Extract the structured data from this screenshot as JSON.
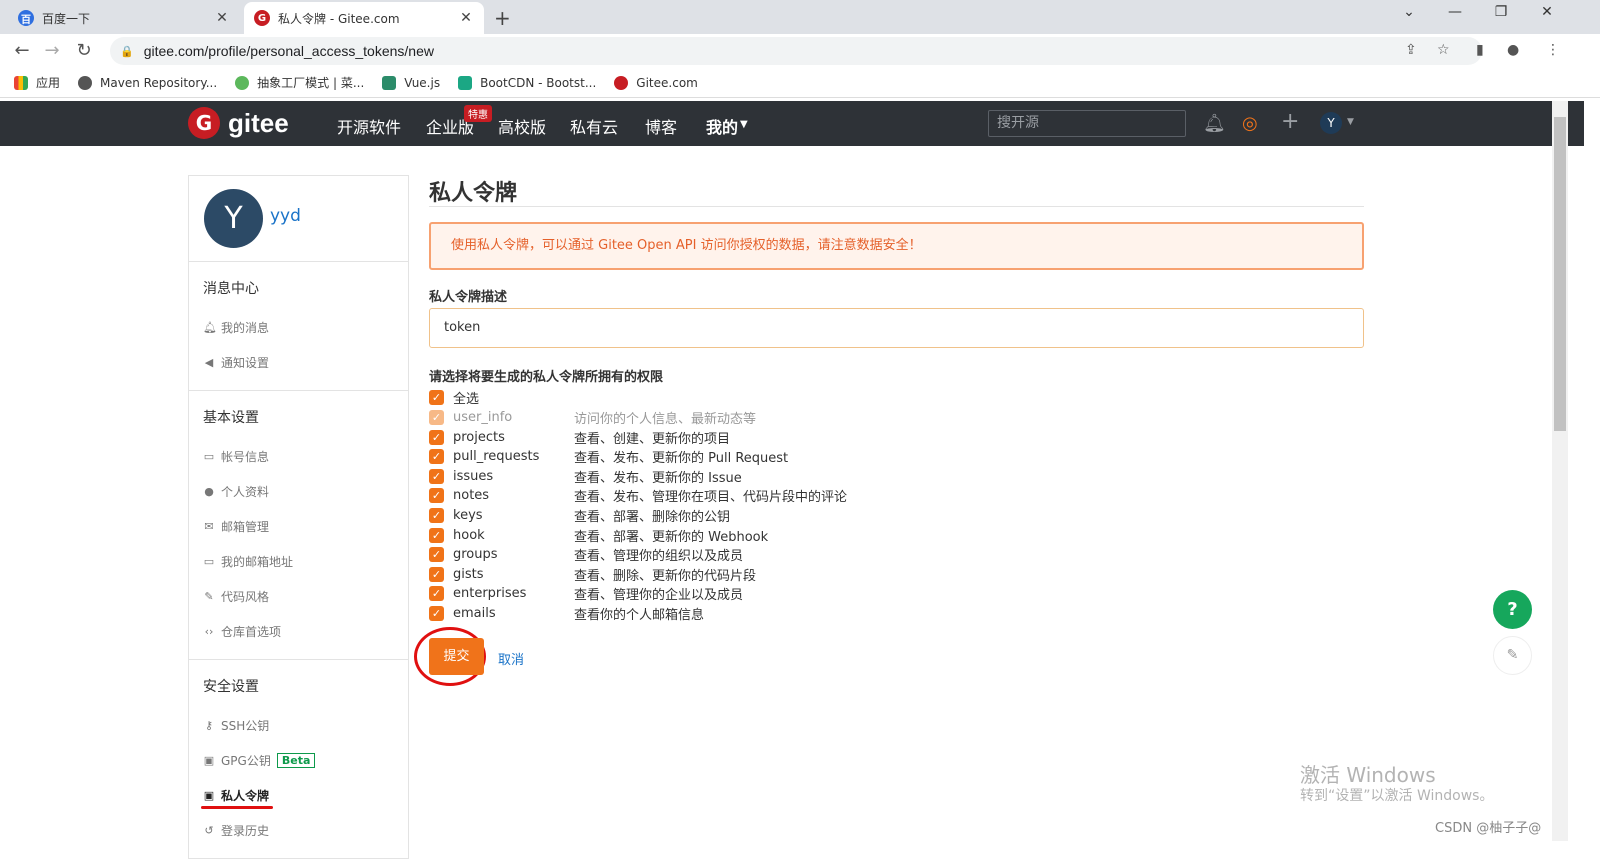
{
  "browser": {
    "tabs": [
      {
        "label": "百度一下",
        "active": false
      },
      {
        "label": "私人令牌 - Gitee.com",
        "active": true
      }
    ],
    "url": "gitee.com/profile/personal_access_tokens/new",
    "bookmarks": [
      "应用",
      "Maven Repository...",
      "抽象工厂模式 | 菜...",
      "Vue.js",
      "BootCDN - Bootst...",
      "Gitee.com"
    ]
  },
  "gitee_nav": {
    "logo_text": "gitee",
    "items": [
      "开源软件",
      "企业版",
      "高校版",
      "私有云",
      "博客",
      "我的"
    ],
    "hot_badge": "特惠",
    "search_placeholder": "搜开源",
    "user_initial": "Y"
  },
  "sidebar": {
    "avatar_initial": "Y",
    "username": "yyd",
    "sections": [
      {
        "title": "消息中心",
        "items": [
          "我的消息",
          "通知设置"
        ]
      },
      {
        "title": "基本设置",
        "items": [
          "帐号信息",
          "个人资料",
          "邮箱管理",
          "我的邮箱地址",
          "代码风格",
          "仓库首选项"
        ]
      },
      {
        "title": "安全设置",
        "items": [
          "SSH公钥",
          "GPG公钥",
          "私人令牌",
          "登录历史"
        ]
      }
    ],
    "beta_label": "Beta",
    "active_item": "私人令牌"
  },
  "main": {
    "title": "私人令牌",
    "alert": "使用私人令牌，可以通过 Gitee Open API 访问你授权的数据，请注意数据安全！",
    "desc_label": "私人令牌描述",
    "desc_value": "token",
    "perm_label": "请选择将要生成的私人令牌所拥有的权限",
    "select_all": "全选",
    "permissions": [
      {
        "name": "user_info",
        "desc": "访问你的个人信息、最新动态等",
        "disabled": true
      },
      {
        "name": "projects",
        "desc": "查看、创建、更新你的项目"
      },
      {
        "name": "pull_requests",
        "desc": "查看、发布、更新你的 Pull Request"
      },
      {
        "name": "issues",
        "desc": "查看、发布、更新你的 Issue"
      },
      {
        "name": "notes",
        "desc": "查看、发布、管理你在项目、代码片段中的评论"
      },
      {
        "name": "keys",
        "desc": "查看、部署、删除你的公钥"
      },
      {
        "name": "hook",
        "desc": "查看、部署、更新你的 Webhook"
      },
      {
        "name": "groups",
        "desc": "查看、管理你的组织以及成员"
      },
      {
        "name": "gists",
        "desc": "查看、删除、更新你的代码片段"
      },
      {
        "name": "enterprises",
        "desc": "查看、管理你的企业以及成员"
      },
      {
        "name": "emails",
        "desc": "查看你的个人邮箱信息"
      }
    ],
    "submit": "提交",
    "cancel": "取消"
  },
  "overlay": {
    "help": "?",
    "watermark_line1": "激活 Windows",
    "watermark_line2": "转到“设置”以激活 Windows。",
    "credit": "CSDN @柚子子@"
  }
}
